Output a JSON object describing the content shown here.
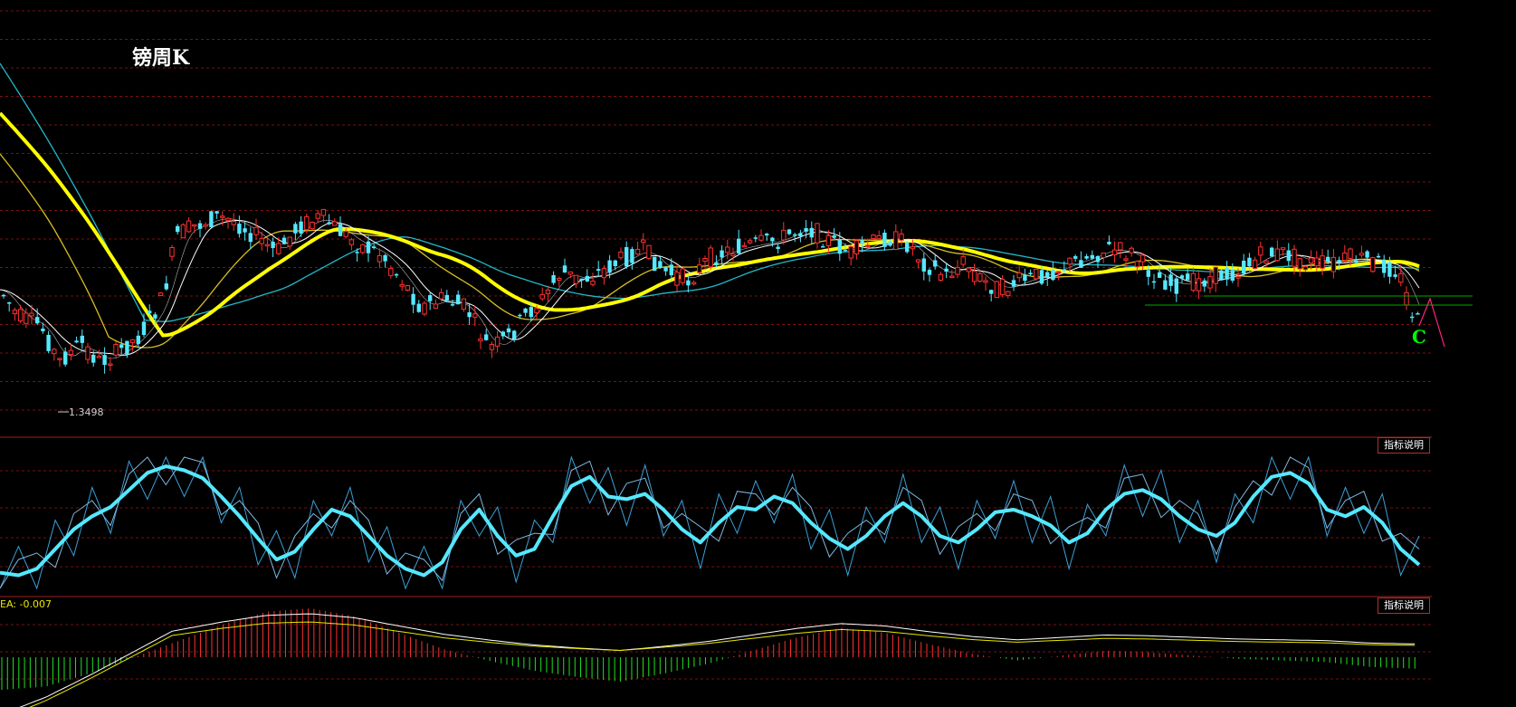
{
  "title": "镑周K",
  "buttons": {
    "indicator_explain_1": "指标说明",
    "indicator_explain_2": "指标说明"
  },
  "macd": {
    "readout": "EA: -0.007"
  },
  "wave_label": "C",
  "colors": {
    "background": "#000000",
    "grid": "#7a1010",
    "candle_up": "#ff3030",
    "candle_down": "#55e8ff",
    "ma_thick": "#ffff00",
    "ma_yellow": "#d8c020",
    "ma_white": "#ffffff",
    "ma_cyan": "#22b8c8",
    "oscillator_main": "#55e8ff",
    "oscillator_thin": "#3aa0d8",
    "macd_pos": "#ff3030",
    "macd_neg": "#20e020",
    "macd_dif": "#ffffff",
    "macd_dea": "#e8e800",
    "support_line": "#00aa00",
    "wave_marker": "#ff2080"
  },
  "chart_data": [
    {
      "type": "candlestick",
      "title": "镑周K",
      "min_label": "1.3498",
      "series_note": "weekly candles with moving averages",
      "grid": true,
      "annotations": [
        {
          "text": "C"
        }
      ]
    },
    {
      "type": "line",
      "title": "",
      "series": [
        {
          "values": [
            0.12,
            0.1,
            0.15,
            0.3,
            0.45,
            0.55,
            0.62,
            0.75,
            0.88,
            0.93,
            0.9,
            0.84,
            0.7,
            0.55,
            0.38,
            0.22,
            0.28,
            0.45,
            0.6,
            0.55,
            0.4,
            0.25,
            0.15,
            0.1,
            0.2,
            0.45,
            0.6,
            0.4,
            0.25,
            0.3,
            0.55,
            0.78,
            0.85,
            0.7,
            0.68,
            0.72,
            0.6,
            0.45,
            0.35,
            0.5,
            0.62,
            0.6,
            0.7,
            0.65,
            0.5,
            0.38,
            0.3,
            0.4,
            0.55,
            0.65,
            0.55,
            0.4,
            0.35,
            0.45,
            0.58,
            0.6,
            0.55,
            0.48,
            0.35,
            0.42,
            0.6,
            0.72,
            0.75,
            0.68,
            0.55,
            0.45,
            0.4,
            0.5,
            0.7,
            0.85,
            0.88,
            0.8,
            0.6,
            0.55,
            0.62,
            0.5,
            0.3,
            0.18
          ]
        }
      ],
      "grid": true
    },
    {
      "type": "bar",
      "title": "",
      "series": [
        {
          "name": "EA",
          "values": [
            -0.02,
            -0.018,
            -0.01,
            0,
            0.01,
            0.02,
            0.028,
            0.03,
            0.025,
            0.015,
            0.005,
            -0.002,
            -0.008,
            -0.012,
            -0.015,
            -0.01,
            -0.004,
            0.004,
            0.012,
            0.018,
            0.015,
            0.008,
            0.002,
            -0.002,
            0.001,
            0.004,
            0.003,
            0.001,
            -0.001,
            -0.002,
            -0.003,
            -0.006,
            -0.007
          ]
        }
      ],
      "grid": true
    }
  ]
}
